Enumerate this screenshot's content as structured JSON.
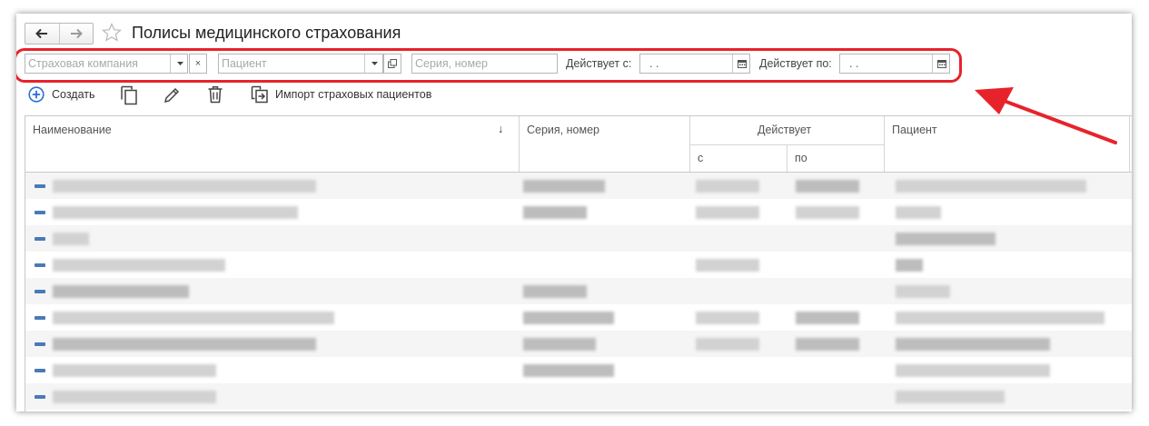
{
  "window": {
    "title": "Полисы медицинского страхования",
    "nav_back_icon": "arrow-left-icon",
    "nav_forward_icon": "arrow-right-icon",
    "favorite_icon": "star-icon"
  },
  "filters": {
    "insurance_company": {
      "placeholder": "Страховая компания",
      "value": ""
    },
    "patient": {
      "placeholder": "Пациент",
      "value": ""
    },
    "series_number": {
      "placeholder": "Серия, номер",
      "value": ""
    },
    "valid_from_label": "Действует с:",
    "valid_from_value": " .  .",
    "valid_to_label": "Действует по:",
    "valid_to_value": " .  .",
    "clear_symbol": "×"
  },
  "toolbar": {
    "create_label": "Создать",
    "import_label": "Импорт страховых пациентов"
  },
  "table": {
    "columns": {
      "name": "Наименование",
      "sort_indicator": "↓",
      "series_number": "Серия, номер",
      "valid": "Действует",
      "valid_from": "с",
      "valid_to": "по",
      "patient": "Пациент"
    },
    "rows": [
      {
        "status": "active",
        "name": "",
        "series": "",
        "from": "",
        "to": "",
        "patient": ""
      },
      {
        "status": "active",
        "name": "",
        "series": "",
        "from": "",
        "to": "",
        "patient": ""
      },
      {
        "status": "active",
        "name": "",
        "series": "",
        "from": "",
        "to": "",
        "patient": ""
      },
      {
        "status": "active",
        "name": "",
        "series": "",
        "from": "",
        "to": "",
        "patient": ""
      },
      {
        "status": "active",
        "name": "",
        "series": "",
        "from": "",
        "to": "",
        "patient": ""
      },
      {
        "status": "active",
        "name": "",
        "series": "",
        "from": "",
        "to": "",
        "patient": ""
      },
      {
        "status": "active",
        "name": "",
        "series": "",
        "from": "",
        "to": "",
        "patient": ""
      },
      {
        "status": "active",
        "name": "",
        "series": "",
        "from": "",
        "to": "",
        "patient": ""
      },
      {
        "status": "active",
        "name": "",
        "series": "",
        "from": "",
        "to": "",
        "patient": ""
      }
    ]
  },
  "colors": {
    "highlight": "#e8222b",
    "accent": "#2a6fd6",
    "row_marker": "#4a79b8"
  }
}
